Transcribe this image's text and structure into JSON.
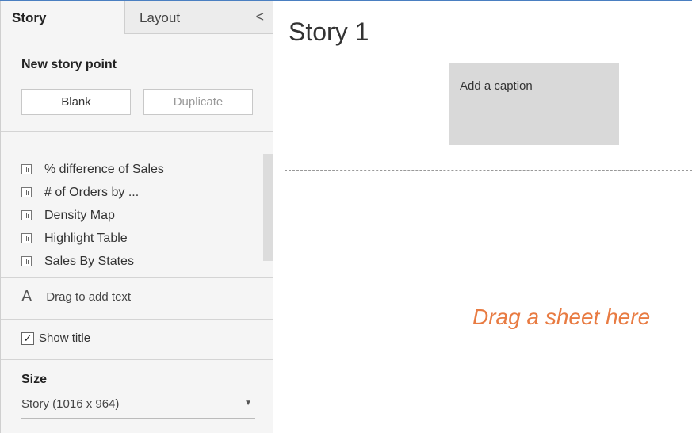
{
  "tabs": {
    "story": "Story",
    "layout": "Layout",
    "collapse_glyph": "<"
  },
  "new_story_point": {
    "title": "New story point",
    "blank_label": "Blank",
    "duplicate_label": "Duplicate"
  },
  "sheets": [
    {
      "label": "% difference of Sales",
      "icon": "sheet-icon"
    },
    {
      "label": "# of Orders by ...",
      "icon": "sheet-icon"
    },
    {
      "label": "Density Map",
      "icon": "sheet-icon"
    },
    {
      "label": "Highlight Table",
      "icon": "sheet-icon"
    },
    {
      "label": "Sales By States",
      "icon": "sheet-icon"
    }
  ],
  "text_object": {
    "glyph": "A",
    "label": "Drag to add text"
  },
  "show_title": {
    "checked": true,
    "check_glyph": "✓",
    "label": "Show title"
  },
  "size": {
    "label": "Size",
    "value": "Story (1016 x 964)",
    "arrow": "▼"
  },
  "story": {
    "title": "Story 1",
    "caption": "Add a caption",
    "drop_text": "Drag a sheet here",
    "drop_text_color": "#e87b42"
  }
}
